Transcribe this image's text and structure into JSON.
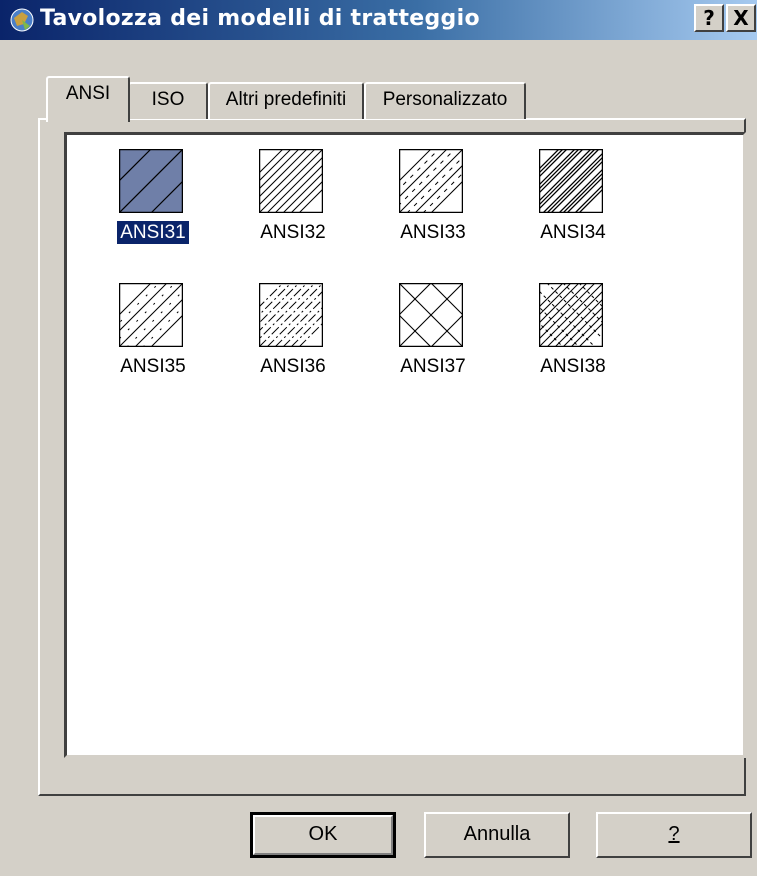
{
  "window": {
    "title": "Tavolozza dei modelli di tratteggio",
    "help_button": "?",
    "close_button": "X"
  },
  "tabs": [
    {
      "label": "ANSI",
      "active": true
    },
    {
      "label": "ISO",
      "active": false
    },
    {
      "label": "Altri predefiniti",
      "active": false
    },
    {
      "label": "Personalizzato",
      "active": false
    }
  ],
  "patterns": [
    {
      "name": "ANSI31",
      "selected": true
    },
    {
      "name": "ANSI32",
      "selected": false
    },
    {
      "name": "ANSI33",
      "selected": false
    },
    {
      "name": "ANSI34",
      "selected": false
    },
    {
      "name": "ANSI35",
      "selected": false
    },
    {
      "name": "ANSI36",
      "selected": false
    },
    {
      "name": "ANSI37",
      "selected": false
    },
    {
      "name": "ANSI38",
      "selected": false
    }
  ],
  "buttons": {
    "ok": "OK",
    "cancel": "Annulla",
    "help": "?"
  },
  "colors": {
    "title_start": "#0a246a",
    "title_end": "#a6caf0",
    "selection": "#0a246a",
    "selected_swatch_fill": "#6f7fa8",
    "face": "#d4d0c8"
  }
}
